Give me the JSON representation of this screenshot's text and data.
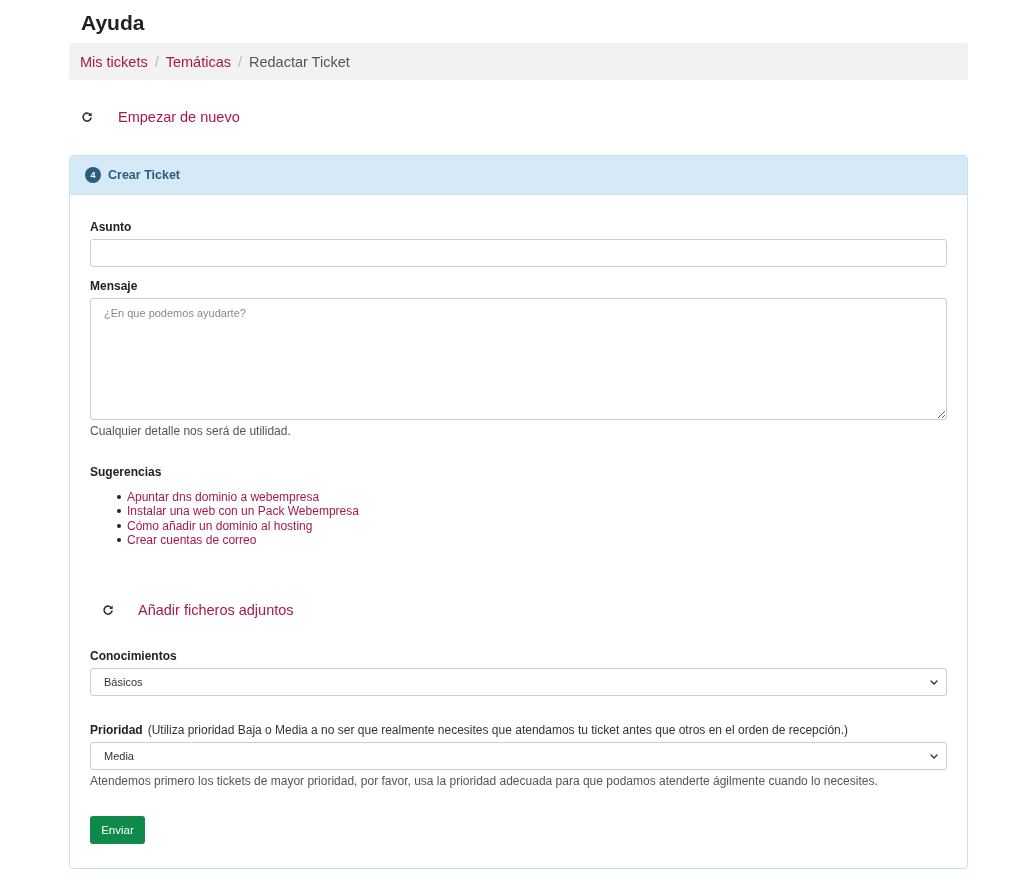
{
  "page": {
    "title": "Ayuda"
  },
  "breadcrumbs": [
    {
      "kind": "link",
      "label": "Mis tickets"
    },
    {
      "kind": "separator",
      "label": "/"
    },
    {
      "kind": "link",
      "label": "Temáticas"
    },
    {
      "kind": "separator",
      "label": "/"
    },
    {
      "kind": "current",
      "label": "Redactar Ticket"
    }
  ],
  "restart_link": {
    "label": "Empezar de nuevo"
  },
  "panel": {
    "step": "4",
    "title": "Crear Ticket",
    "subject": {
      "label": "Asunto"
    },
    "message": {
      "label": "Mensaje",
      "placeholder": "¿En que podemos ayudarte?",
      "help": "Cualquier detalle nos será de utilidad."
    },
    "suggestions": {
      "title": "Sugerencias",
      "items": [
        "Apuntar dns dominio a webempresa",
        "Instalar una web con un Pack Webempresa",
        "Cómo añadir un dominio al hosting",
        "Crear cuentas de correo"
      ]
    },
    "attachments_link": {
      "label": "Añadir ficheros adjuntos"
    },
    "knowledge": {
      "label": "Conocimientos",
      "value": "Básicos"
    },
    "priority": {
      "label": "Prioridad",
      "note": "(Utiliza prioridad Baja o Media a no ser que realmente necesites que atendamos tu ticket antes que otros en el orden de recepción.)",
      "value": "Media",
      "help": "Atendemos primero los tickets de mayor prioridad, por favor, usa la prioridad adecuada para que podamos atenderte ágilmente cuando lo necesites."
    },
    "submit_button": {
      "label": "Enviar"
    }
  }
}
